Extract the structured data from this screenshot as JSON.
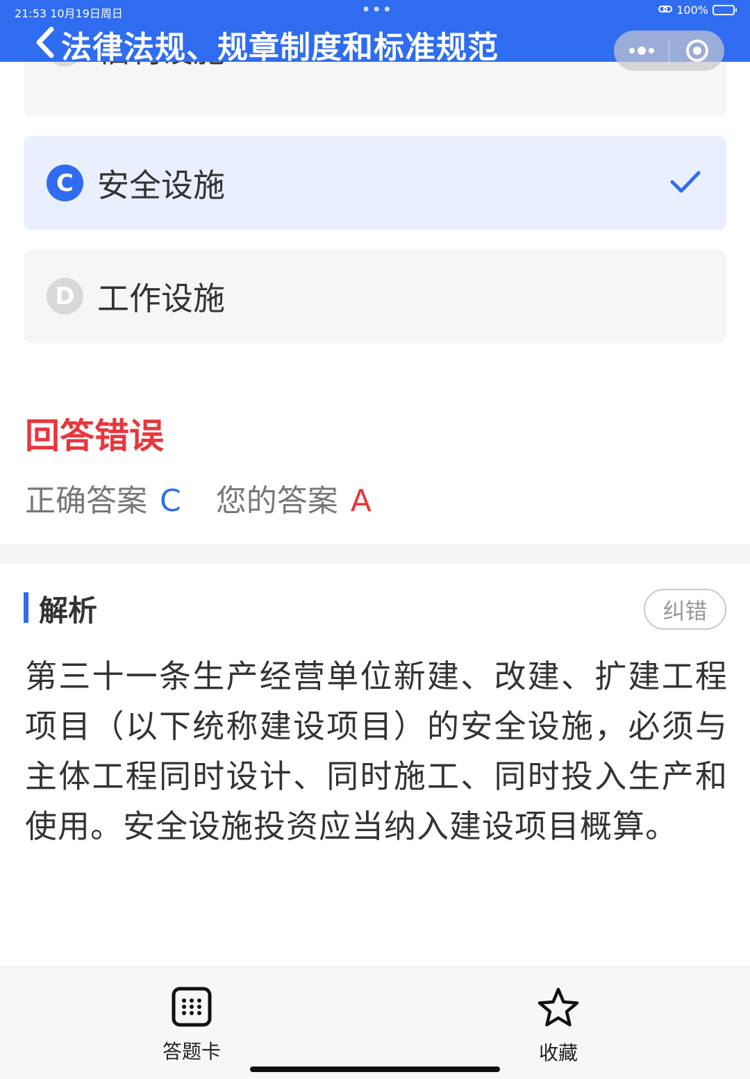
{
  "status_bar": {
    "time": "21:53  10月19日周日",
    "dots": "•••",
    "battery": "100%"
  },
  "header": {
    "title": "法律法规、规章制度和标准规范"
  },
  "options": [
    {
      "letter": "B",
      "text": "福利设施",
      "selected": false
    },
    {
      "letter": "C",
      "text": "安全设施",
      "selected": true
    },
    {
      "letter": "D",
      "text": "工作设施",
      "selected": false
    }
  ],
  "result": {
    "title": "回答错误",
    "correct_label": "正确答案",
    "correct_value": "C",
    "yours_label": "您的答案",
    "yours_value": "A"
  },
  "analysis": {
    "title": "解析",
    "report_button": "纠错",
    "text": "第三十一条生产经营单位新建、改建、扩建工程项目（以下统称建设项目）的安全设施，必须与主体工程同时设计、同时施工、同时投入生产和使用。安全设施投资应当纳入建设项目概算。"
  },
  "bottom_bar": {
    "card_label": "答题卡",
    "favorite_label": "收藏"
  },
  "colors": {
    "accent": "#2f6cf0",
    "error": "#e8363c"
  }
}
